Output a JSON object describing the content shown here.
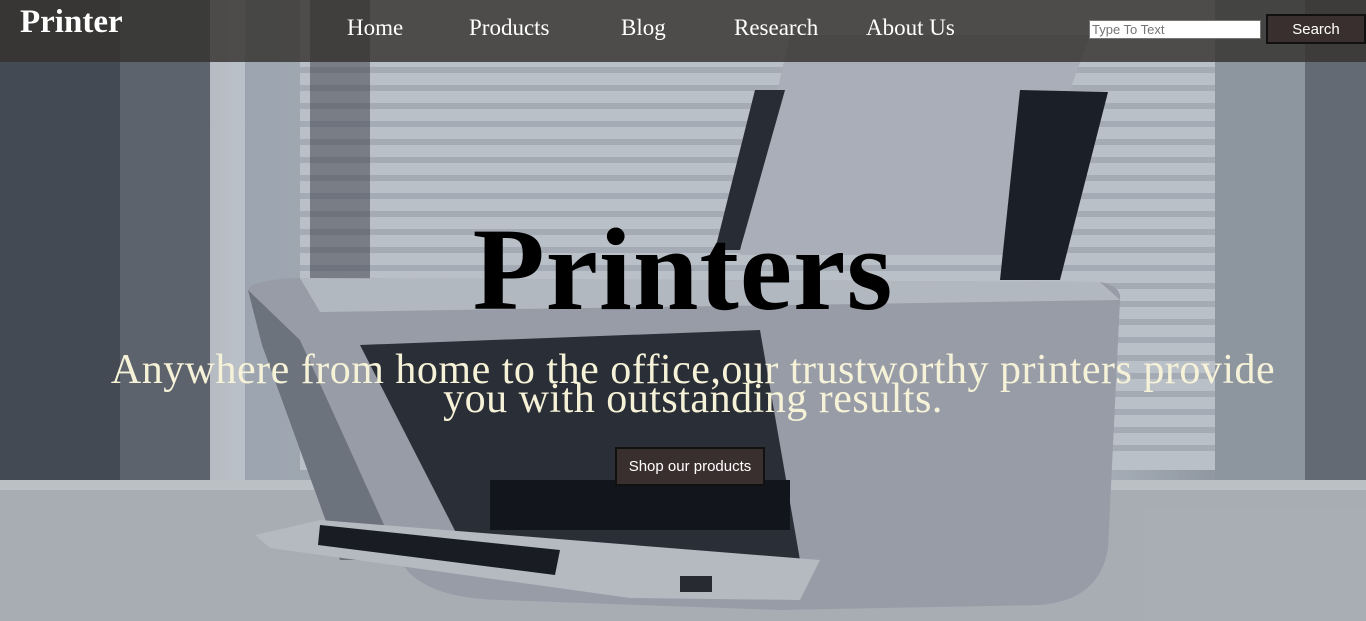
{
  "header": {
    "logo": "Printer",
    "nav": {
      "home": "Home",
      "products": "Products",
      "blog": "Blog",
      "research": "Research",
      "about": "About Us"
    },
    "search": {
      "placeholder": "Type To Text",
      "value": "",
      "button_label": "Search"
    }
  },
  "hero": {
    "title": "Printers",
    "subtitle": "Anywhere from home to the office,our trustworthy printers provide you with outstanding results.",
    "cta_label": "Shop our products",
    "background_image": "printer-on-desk-by-window"
  },
  "colors": {
    "navbar_bg": "#34322e",
    "button_bg": "#3a2f2f",
    "subtitle_text": "#f6f2d8",
    "title_text": "#000000"
  }
}
